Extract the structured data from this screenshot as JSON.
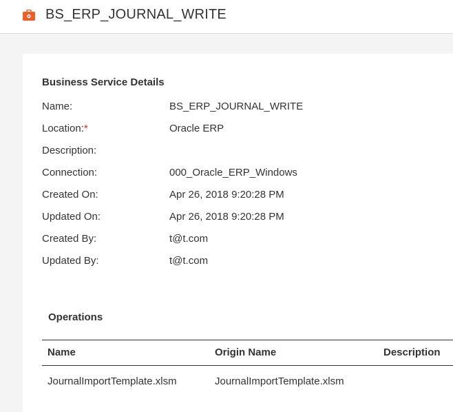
{
  "header": {
    "icon": "briefcase-icon",
    "icon_color": "#e8622c",
    "title": "BS_ERP_JOURNAL_WRITE"
  },
  "details": {
    "section_title": "Business Service Details",
    "rows": [
      {
        "label": "Name:",
        "value": "BS_ERP_JOURNAL_WRITE"
      },
      {
        "label": "Location:",
        "required_marker": "*",
        "value": "Oracle ERP"
      },
      {
        "label": "Description:",
        "value": ""
      },
      {
        "label": "Connection:",
        "value": "000_Oracle_ERP_Windows"
      },
      {
        "label": "Created On:",
        "value": "Apr 26, 2018 9:20:28 PM"
      },
      {
        "label": "Updated On:",
        "value": "Apr 26, 2018 9:20:28 PM"
      },
      {
        "label": "Created By:",
        "value": "t@t.com"
      },
      {
        "label": "Updated By:",
        "value": "t@t.com"
      }
    ]
  },
  "operations": {
    "title": "Operations",
    "columns": [
      "Name",
      "Origin Name",
      "Description"
    ],
    "rows": [
      {
        "name": "JournalImportTemplate.xlsm",
        "origin_name": "JournalImportTemplate.xlsm",
        "description": ""
      }
    ]
  }
}
